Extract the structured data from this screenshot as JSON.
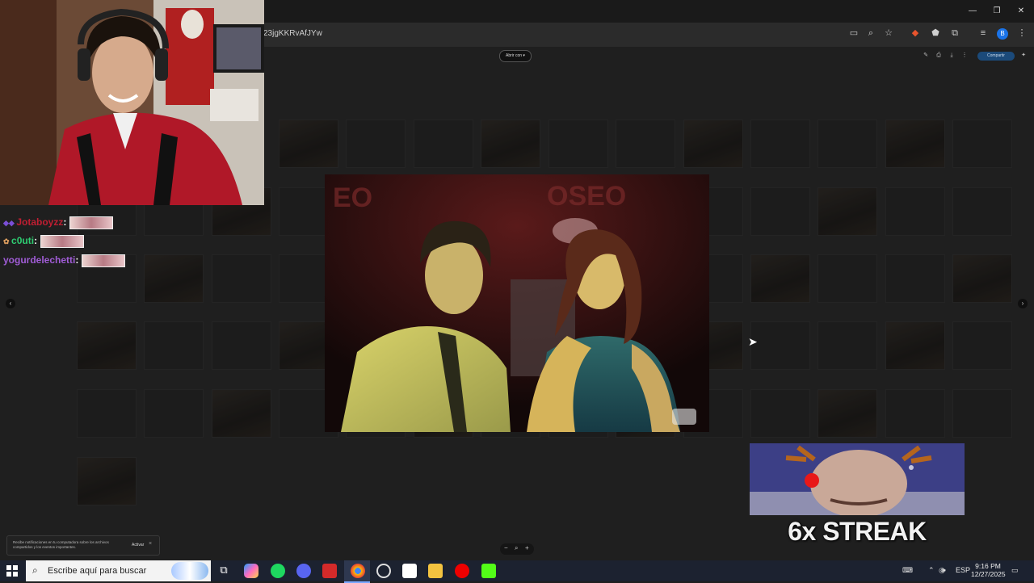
{
  "browser": {
    "url_fragment": "23jgKKRvAfJYw",
    "window_controls": [
      "minimize-icon",
      "restore-icon",
      "close-icon"
    ],
    "account_initial": "B",
    "toolbar_icons": [
      "cast-icon",
      "zoom-icon",
      "bookmark-star-icon",
      "extension-fox-icon",
      "extension-icon",
      "puzzle-icon",
      "media-icon",
      "menu-dots-icon"
    ]
  },
  "viewer": {
    "open_with_label": "Abrir con",
    "share_label": "Compartir",
    "zoom_minus": "−",
    "zoom_plus": "+",
    "prev_arrow": "‹",
    "next_arrow": "›"
  },
  "chat": {
    "messages": [
      {
        "user": "Jotaboyzz",
        "sep": ":",
        "color": "#c01e32"
      },
      {
        "user": "c0uti",
        "sep": ":",
        "color": "#2ecc71"
      },
      {
        "user": "yogurdelechetti",
        "sep": ":",
        "color": "#a05cd6"
      }
    ]
  },
  "notification": {
    "text": "Recibe notificaciones en tu computadora sobre los archivos compartidos y los eventos importantes.",
    "action": "Activar",
    "close": "×"
  },
  "streak": {
    "label": "6x STREAK"
  },
  "taskbar": {
    "search_placeholder": "Escribe aquí para buscar",
    "language": "ESP",
    "time": "9:16 PM",
    "date": "12/27/2025"
  }
}
